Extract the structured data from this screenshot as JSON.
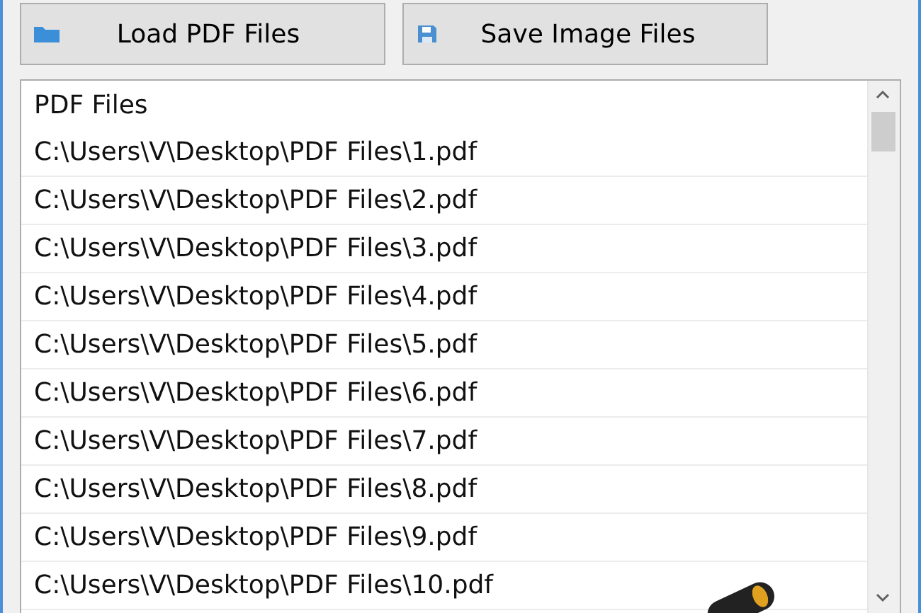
{
  "toolbar": {
    "buttons": [
      {
        "label": "Load PDF Files",
        "kind": "open"
      },
      {
        "label": "Save Image Files",
        "kind": "save"
      }
    ]
  },
  "file_list": {
    "heading": "PDF Files",
    "items": [
      {
        "path": "C:\\Users\\V\\Desktop\\PDF Files\\1.pdf"
      },
      {
        "path": "C:\\Users\\V\\Desktop\\PDF Files\\2.pdf"
      },
      {
        "path": "C:\\Users\\V\\Desktop\\PDF Files\\3.pdf"
      },
      {
        "path": "C:\\Users\\V\\Desktop\\PDF Files\\4.pdf"
      },
      {
        "path": "C:\\Users\\V\\Desktop\\PDF Files\\5.pdf"
      },
      {
        "path": "C:\\Users\\V\\Desktop\\PDF Files\\6.pdf"
      },
      {
        "path": "C:\\Users\\V\\Desktop\\PDF Files\\7.pdf"
      },
      {
        "path": "C:\\Users\\V\\Desktop\\PDF Files\\8.pdf"
      },
      {
        "path": "C:\\Users\\V\\Desktop\\PDF Files\\9.pdf"
      },
      {
        "path": "C:\\Users\\V\\Desktop\\PDF Files\\10.pdf"
      }
    ]
  }
}
